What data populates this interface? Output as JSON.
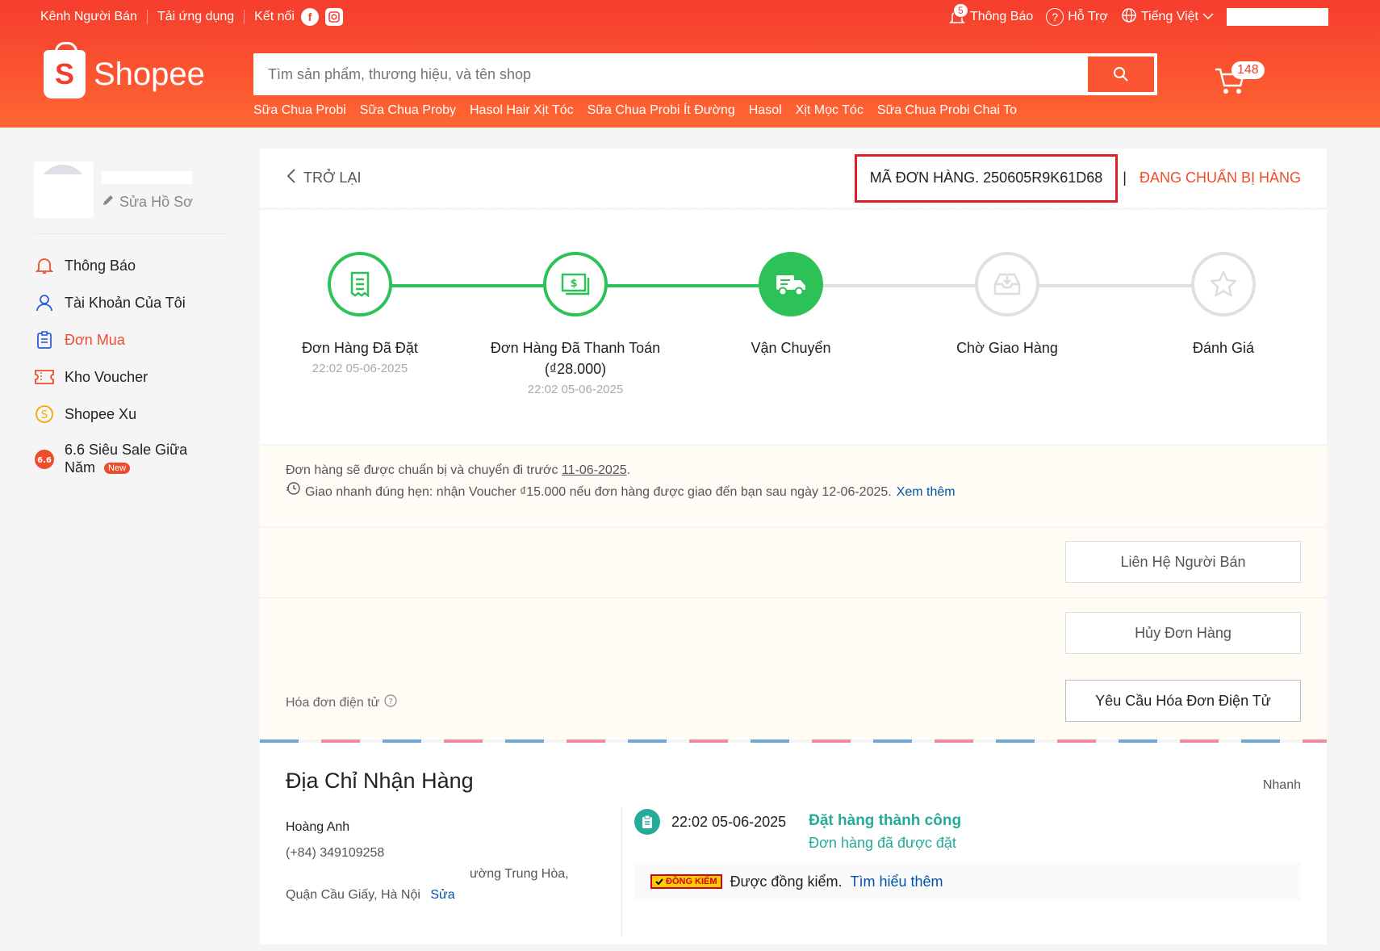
{
  "topbar": {
    "seller_center": "Kênh Người Bán",
    "download_app": "Tải ứng dụng",
    "connect": "Kết nối",
    "notifications": "Thông Báo",
    "notification_count": "5",
    "help": "Hỗ Trợ",
    "language": "Tiếng Việt"
  },
  "brand": {
    "name": "Shopee",
    "primary_color": "#ee4d2d"
  },
  "search": {
    "placeholder": "Tìm sản phẩm, thương hiệu, và tên shop",
    "suggestions": [
      "Sữa Chua Probi",
      "Sữa Chua Proby",
      "Hasol Hair Xịt Tóc",
      "Sữa Chua Probi Ít Đường",
      "Hasol",
      "Xịt Mọc Tóc",
      "Sữa Chua Probi Chai To"
    ]
  },
  "cart": {
    "count": "148"
  },
  "sidebar": {
    "edit_profile": "Sửa Hồ Sơ",
    "items": [
      {
        "label": "Thông Báo",
        "icon": "bell-icon"
      },
      {
        "label": "Tài Khoản Của Tôi",
        "icon": "user-icon"
      },
      {
        "label": "Đơn Mua",
        "icon": "clipboard-icon",
        "active": true
      },
      {
        "label": "Kho Voucher",
        "icon": "voucher-icon"
      },
      {
        "label": "Shopee Xu",
        "icon": "coin-icon"
      },
      {
        "label": "6.6 Siêu Sale Giữa Năm",
        "icon": "sale-66-icon",
        "badge": "New"
      }
    ]
  },
  "order": {
    "back_label": "TRỞ LẠI",
    "order_id_label": "MÃ ĐƠN HÀNG. 250605R9K61D68",
    "status": "ĐANG CHUẨN BỊ HÀNG"
  },
  "steps": [
    {
      "label": "Đơn Hàng Đã Đặt",
      "time": "22:02 05-06-2025",
      "state": "done"
    },
    {
      "label": "Đơn Hàng Đã Thanh Toán (₫28.000)",
      "time": "22:02 05-06-2025",
      "state": "done"
    },
    {
      "label": "Vận Chuyển",
      "time": "",
      "state": "current"
    },
    {
      "label": "Chờ Giao Hàng",
      "time": "",
      "state": "pending"
    },
    {
      "label": "Đánh Giá",
      "time": "",
      "state": "pending"
    }
  ],
  "info": {
    "prepare_text": "Đơn hàng sẽ được chuẩn bị và chuyển đi trước",
    "prepare_date": "11-06-2025",
    "fast_delivery": "Giao nhanh đúng hẹn: nhận Voucher ₫15.000 nếu đơn hàng được giao đến bạn sau ngày 12-06-2025.",
    "see_more": "Xem thêm"
  },
  "actions": {
    "contact_seller": "Liên Hệ Người Bán",
    "cancel_order": "Hủy Đơn Hàng",
    "request_einvoice": "Yêu Cầu Hóa Đơn Điện Tử",
    "einvoice_label": "Hóa đơn điện tử"
  },
  "address": {
    "title": "Địa Chỉ Nhận Hàng",
    "shipping_type": "Nhanh",
    "line_name": "Hoàng Anh",
    "line_phone": "(+84) 349109258",
    "line_street": "ường Trung Hòa,",
    "line_district": "Quận Cầu Giấy, Hà Nội",
    "line_edit": "Sửa"
  },
  "tracking": {
    "time": "22:02 05-06-2025",
    "title": "Đặt hàng thành công",
    "subtitle": "Đơn hàng đã được đặt",
    "inspect_badge": "ĐỒNG KIỂM",
    "inspect_text": "Được đồng kiểm.",
    "inspect_link": "Tìm hiểu thêm"
  }
}
